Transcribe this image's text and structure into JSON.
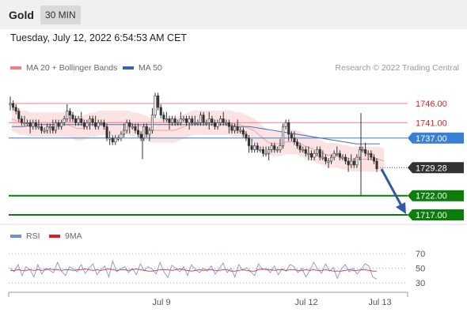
{
  "header": {
    "instrument": "Gold",
    "timeframe": "30 MIN"
  },
  "datetime": "Tuesday, July 12, 2022 6:54:53 AM CET",
  "legend": {
    "ma20": {
      "label": "MA 20 + Bollinger Bands",
      "color": "#f08080"
    },
    "ma50": {
      "label": "MA 50",
      "color": "#3a62a7"
    }
  },
  "credit": "Research © 2022 Trading Central",
  "rsi_legend": {
    "rsi": {
      "label": "RSI",
      "color": "#6a8fdd"
    },
    "ma9": {
      "label": "9MA",
      "color": "#e02020"
    }
  },
  "chart_data": {
    "type": "candlestick",
    "x_ticks": [
      "Jul 9",
      "Jul 12",
      "Jul 13"
    ],
    "y_range": [
      1713,
      1751
    ],
    "levels": [
      {
        "label": "1746.00",
        "value": 1746.0,
        "kind": "resistance",
        "color": "#f08080"
      },
      {
        "label": "1741.00",
        "value": 1741.0,
        "kind": "resistance",
        "color": "#f08080"
      },
      {
        "label": "1737.00",
        "value": 1737.0,
        "kind": "pivot",
        "color": "#3a7fd6"
      },
      {
        "label": "1729.28",
        "value": 1729.28,
        "kind": "last",
        "color": "#333333"
      },
      {
        "label": "1722.00",
        "value": 1722.0,
        "kind": "support",
        "color": "#0a7d0a"
      },
      {
        "label": "1717.00",
        "value": 1717.0,
        "kind": "support",
        "color": "#0a7d0a"
      }
    ],
    "closes": [
      1746,
      1745,
      1744,
      1742,
      1741,
      1741,
      1741,
      1740,
      1741,
      1740,
      1740,
      1739,
      1739,
      1740,
      1740,
      1739,
      1741,
      1740,
      1741,
      1742,
      1744,
      1743,
      1742,
      1741,
      1742,
      1741,
      1740,
      1741,
      1742,
      1741,
      1740,
      1741,
      1741,
      1740,
      1737,
      1737,
      1736,
      1737,
      1737,
      1738,
      1739,
      1741,
      1740,
      1740,
      1739,
      1738,
      1737,
      1740,
      1738,
      1739,
      1743,
      1748,
      1745,
      1743,
      1742,
      1742,
      1741,
      1742,
      1741,
      1741,
      1742,
      1742,
      1741,
      1742,
      1741,
      1741,
      1741,
      1743,
      1741,
      1741,
      1742,
      1741,
      1740,
      1741,
      1742,
      1741,
      1741,
      1740,
      1739,
      1740,
      1739,
      1739,
      1738,
      1737,
      1735,
      1734,
      1735,
      1734,
      1734,
      1733,
      1733,
      1734,
      1735,
      1734,
      1734,
      1735,
      1740,
      1741,
      1738,
      1737,
      1736,
      1735,
      1734,
      1734,
      1733,
      1733,
      1732,
      1733,
      1734,
      1732,
      1732,
      1731,
      1731,
      1732,
      1733,
      1733,
      1732,
      1732,
      1731,
      1730,
      1731,
      1730,
      1732,
      1734,
      1734,
      1733,
      1733,
      1732,
      1731,
      1729
    ],
    "ma20_approx": [
      1742,
      1741.5,
      1741,
      1741,
      1740.5,
      1740.5,
      1740.5,
      1740.5,
      1740.5,
      1740.5,
      1740.5,
      1740.5,
      1740.5,
      1740,
      1739.5,
      1739.5,
      1740,
      1740.5,
      1740.5,
      1741,
      1741,
      1741,
      1741,
      1741,
      1741,
      1741,
      1740.5,
      1740.5,
      1740,
      1739.5,
      1739,
      1739,
      1739,
      1739,
      1739,
      1739,
      1739.5,
      1740,
      1740.5,
      1741,
      1741,
      1741,
      1741,
      1741,
      1741,
      1741,
      1741,
      1741,
      1740.5,
      1740.5,
      1740,
      1739.5,
      1739,
      1738,
      1737,
      1736,
      1735.5,
      1735.5,
      1735.5,
      1736,
      1736,
      1736,
      1735.5,
      1735,
      1734.5,
      1734,
      1733.5,
      1733,
      1732.5,
      1732.5,
      1732.5,
      1732,
      1732,
      1731.5,
      1731.5,
      1731.5,
      1731.5,
      1731.5,
      1731.5,
      1731.5,
      1731
    ],
    "ma50_approx": [
      1740,
      1740,
      1740.5,
      1740.5,
      1740.5,
      1740.5,
      1740.5,
      1740.5,
      1740.5,
      1740.5,
      1740.5,
      1740.5,
      1740.5,
      1740.5,
      1740.5,
      1740.5,
      1740.5,
      1740.5,
      1740.5,
      1740,
      1740,
      1739.5,
      1739,
      1738.5,
      1738,
      1737.5,
      1737,
      1736.5,
      1736,
      1735.5,
      1735.5,
      1735.5
    ],
    "rsi": {
      "y_ticks": [
        "70",
        "50",
        "30"
      ],
      "y_range": [
        20,
        80
      ],
      "levels": [
        70,
        50,
        30
      ],
      "rsi_values": [
        50,
        45,
        55,
        40,
        52,
        48,
        38,
        55,
        42,
        50,
        47,
        44,
        58,
        46,
        40,
        52,
        49,
        45,
        55,
        43,
        50,
        56,
        41,
        48,
        53,
        38,
        60,
        45,
        49,
        52,
        44,
        50,
        41,
        56,
        47,
        52,
        49,
        42,
        58,
        45,
        37,
        54,
        50,
        45,
        52,
        40,
        55,
        48,
        44,
        50,
        46,
        53,
        42,
        49,
        57,
        44,
        50,
        38,
        55,
        47,
        51,
        45,
        40,
        56,
        48,
        50,
        44,
        53,
        41,
        49,
        46,
        55,
        52,
        44,
        50,
        38,
        47,
        58,
        49,
        43,
        56,
        46,
        51,
        36,
        49,
        55,
        45,
        50,
        42,
        48,
        56,
        53,
        38,
        35
      ],
      "ma9_values": [
        47,
        47,
        48,
        47,
        47,
        48,
        47,
        48,
        47,
        48,
        49,
        48,
        48,
        47,
        48,
        48,
        47,
        48,
        48,
        49,
        48,
        47,
        48,
        47,
        48,
        49,
        48,
        47,
        48,
        48,
        47,
        48,
        49,
        48,
        47,
        46,
        46,
        47,
        48,
        48,
        48,
        47,
        48,
        49,
        48,
        47,
        46,
        47,
        48,
        47,
        48,
        48,
        47,
        47,
        48,
        48,
        46,
        46,
        47,
        48,
        47,
        46,
        46,
        48,
        49,
        48,
        48,
        47,
        48,
        48,
        47,
        48,
        48,
        47,
        47,
        48,
        47,
        48,
        47,
        47,
        48,
        47,
        46,
        46,
        46,
        47,
        48,
        47,
        47,
        48,
        48,
        47,
        46,
        46
      ]
    }
  }
}
